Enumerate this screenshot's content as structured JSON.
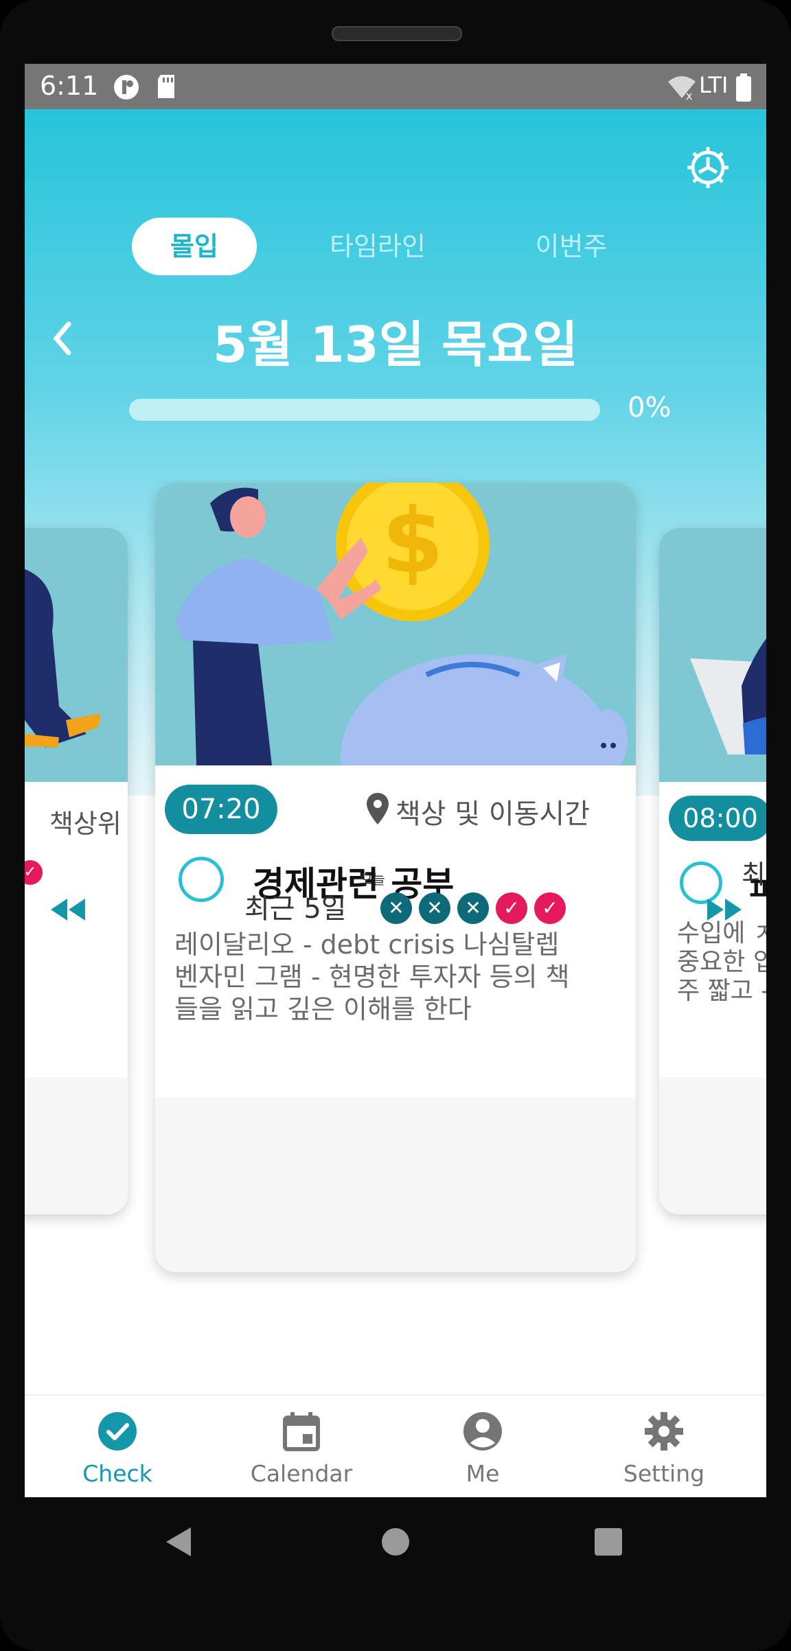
{
  "status_bar": {
    "time": "6:11",
    "network": "LTI"
  },
  "header": {
    "tabs": [
      "몰입",
      "타임라인",
      "이번주"
    ],
    "active_tab": 0,
    "date": "5월 13일 목요일",
    "progress_label": "0%",
    "progress": 0
  },
  "cards": {
    "left": {
      "desc": "책상위"
    },
    "center": {
      "time": "07:20",
      "location": "책상 및 이동시간",
      "title": "경제관련 공부",
      "desc_lines": [
        "레이달리오 - debt crisis 나심탈렙",
        "벤자민 그램 - 현명한 투자자 등의 책",
        "들을 읽고 깊은 이해를 한다"
      ]
    },
    "right": {
      "time": "08:00",
      "title": "ㅍ",
      "desc_lines": [
        "수입에 ㅈ",
        "중요한 입",
        "주 짧고 -"
      ]
    }
  },
  "streak": {
    "label": "최근 5일",
    "today": "오늘",
    "right_partial": "최",
    "days": [
      "x",
      "x",
      "x",
      "ok",
      "ok"
    ]
  },
  "bottom_nav": {
    "items": [
      {
        "label": "Check",
        "icon": "check-circle-icon"
      },
      {
        "label": "Calendar",
        "icon": "calendar-icon"
      },
      {
        "label": "Me",
        "icon": "account-icon"
      },
      {
        "label": "Setting",
        "icon": "gear-icon"
      }
    ],
    "active": 0
  },
  "colors": {
    "accent": "#1597aa",
    "hero_top": "#27c4da",
    "done": "#e4195e",
    "missed": "#0e6a78"
  }
}
